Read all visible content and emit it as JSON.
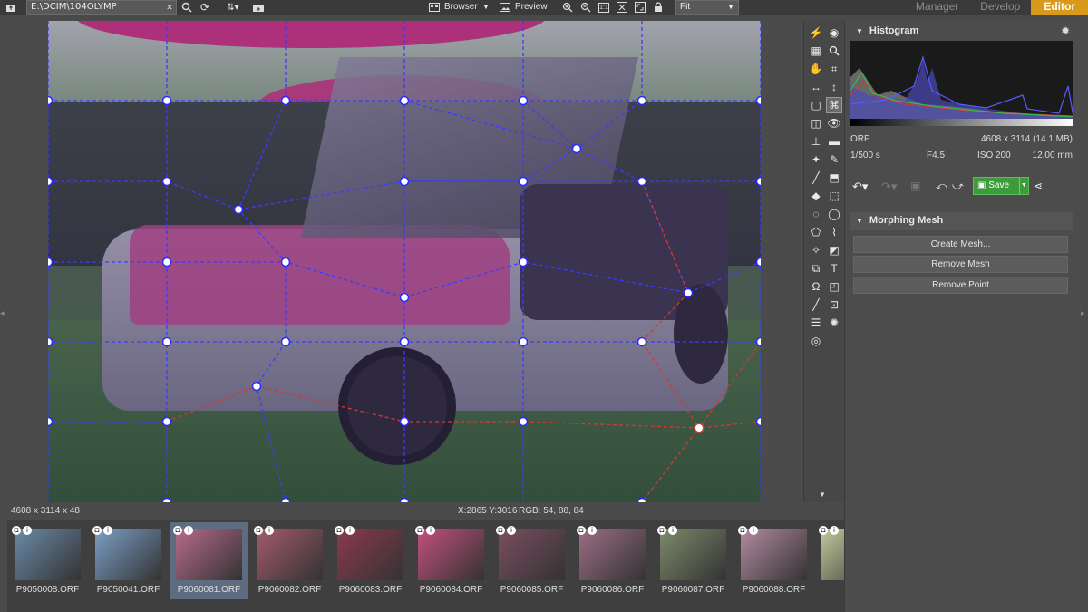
{
  "topbar": {
    "path": "E:\\DCIM\\104OLYMP",
    "browser_label": "Browser",
    "preview_label": "Preview",
    "zoom_option": "Fit",
    "modes": [
      "Manager",
      "Develop",
      "Editor"
    ],
    "active_mode": "Editor"
  },
  "status": {
    "dimensions": "4608 x 3114 x 48",
    "coords": "X:2865 Y:3016",
    "rgb": "RGB: 54, 88, 84"
  },
  "histogram": {
    "title": "Histogram"
  },
  "meta": {
    "format": "ORF",
    "size": "4608 x 3114 (14.1 MB)",
    "shutter": "1/500 s",
    "aperture": "F4.5",
    "iso": "ISO 200",
    "focal": "12.00 mm"
  },
  "actions": {
    "save_label": "Save"
  },
  "morphing": {
    "title": "Morphing Mesh",
    "create": "Create Mesh...",
    "remove": "Remove Mesh",
    "remove_point": "Remove Point"
  },
  "filmstrip": [
    {
      "name": "P9050008.ORF",
      "color": "#6a8aa8"
    },
    {
      "name": "P9050041.ORF",
      "color": "#7b9ec4"
    },
    {
      "name": "P9060081.ORF",
      "color": "#b66a8a"
    },
    {
      "name": "P9060082.ORF",
      "color": "#a35a6e"
    },
    {
      "name": "P9060083.ORF",
      "color": "#8c3850"
    },
    {
      "name": "P9060084.ORF",
      "color": "#c2507a"
    },
    {
      "name": "P9060085.ORF",
      "color": "#7a4e60"
    },
    {
      "name": "P9060086.ORF",
      "color": "#9b6e86"
    },
    {
      "name": "P9060087.ORF",
      "color": "#7c8a6a"
    },
    {
      "name": "P9060088.ORF",
      "color": "#b28aa0"
    },
    {
      "name": "P91",
      "color": "#c2c79a"
    }
  ],
  "colors": {
    "accent": "#d99a1c",
    "save": "#3e9b3c",
    "mesh_blue": "#2a2aff",
    "mesh_red": "#d0302a"
  }
}
